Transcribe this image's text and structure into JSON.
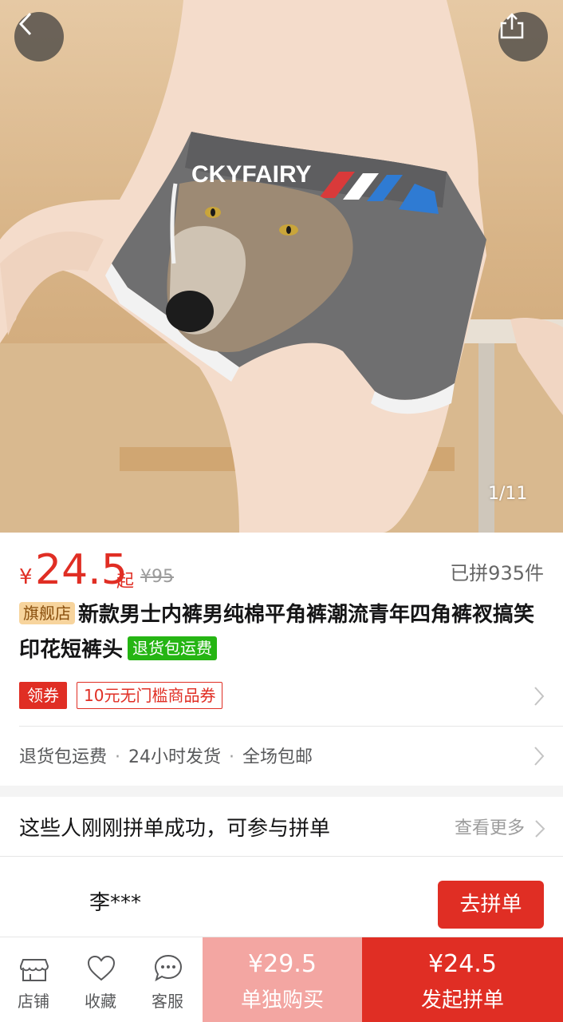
{
  "hero": {
    "brand_text": "CKYFAIRY",
    "page_indicator": "1/11"
  },
  "price": {
    "currency": "¥",
    "value": "24.5",
    "suffix": "起",
    "original": "¥95",
    "sold": "已拼935件"
  },
  "title": {
    "shop_tag": "旗舰店",
    "text": "新款男士内裤男纯棉平角裤潮流青年四角裤衩搞笑印花短裤头",
    "return_tag": "退货包运费"
  },
  "coupon": {
    "badge": "领券",
    "ticket": "10元无门槛商品券"
  },
  "services": [
    "退货包运费",
    "24小时发货",
    "全场包邮"
  ],
  "group": {
    "title": "这些人刚刚拼单成功，可参与拼单",
    "see_more": "查看更多",
    "user": "李***",
    "join": "去拼单"
  },
  "bottom": {
    "shop": "店铺",
    "favorite": "收藏",
    "service": "客服",
    "single_price": "¥29.5",
    "single_label": "单独购买",
    "group_price": "¥24.5",
    "group_label": "发起拼单"
  },
  "colors": {
    "accent": "#e02e24",
    "accent_light": "#f3a6a2",
    "green": "#25b513"
  }
}
